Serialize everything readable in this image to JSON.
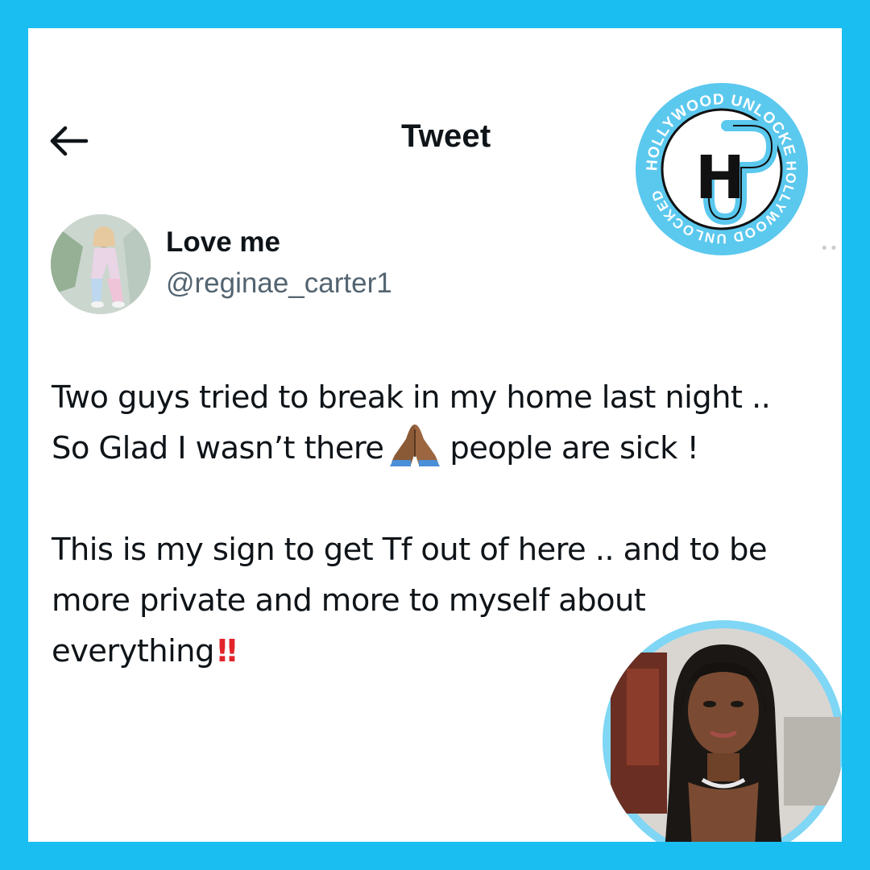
{
  "header": {
    "title": "Tweet",
    "back_icon": "arrow-left-icon",
    "more_icon": "more-icon"
  },
  "author": {
    "display_name": "Love me",
    "handle": "@reginae_carter1"
  },
  "tweet": {
    "line1": "Two guys tried to break in my home last night ..",
    "line2_before": "So Glad I wasn’t there",
    "line2_emoji": "folded-hands-emoji",
    "line2_after": "people are sick !",
    "line3": "This is my sign to get Tf out of here .. and to be",
    "line4": "more private and more to myself about",
    "line5": "everything",
    "line5_emoji": "‼"
  },
  "badge": {
    "top_text": "HOLLYWOOD UNLOCKED",
    "bottom_text": "HOLLYWOOD UNLOCKED",
    "monogram": "H"
  },
  "colors": {
    "frame": "#1bbef0",
    "card": "#ffffff",
    "text": "#0f1419",
    "secondary": "#536471",
    "badge_blue": "#5bc8ee",
    "accent_red": "#e2252b"
  }
}
